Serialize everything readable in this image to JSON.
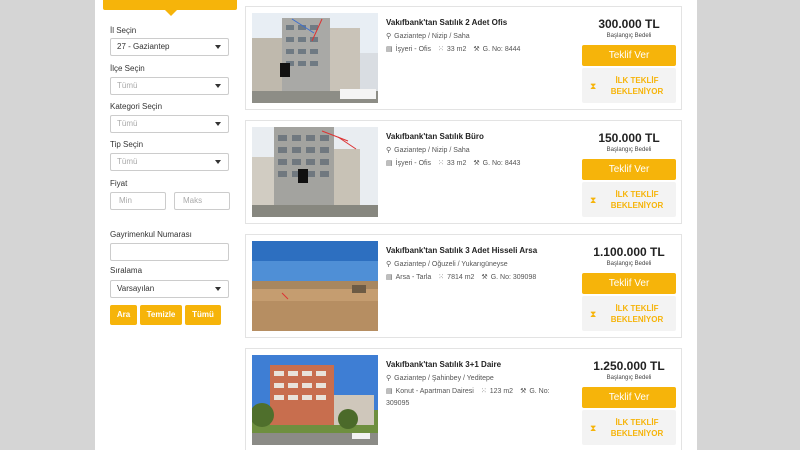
{
  "filters": {
    "il_label": "İl Seçin",
    "il_value": "27 - Gaziantep",
    "ilce_label": "İlçe Seçin",
    "ilce_value": "Tümü",
    "kategori_label": "Kategori Seçin",
    "kategori_value": "Tümü",
    "tip_label": "Tip Seçin",
    "tip_value": "Tümü",
    "fiyat_label": "Fiyat",
    "min_placeholder": "Min",
    "max_placeholder": "Maks",
    "numara_label": "Gayrimenkul Numarası",
    "numara_value": "",
    "siralama_label": "Sıralama",
    "siralama_value": "Varsayılan",
    "btn_ara": "Ara",
    "btn_temizle": "Temizle",
    "btn_tumu": "Tümü"
  },
  "listings": [
    {
      "title": "Vakıfbank'tan Satılık 2 Adet Ofis",
      "location": "Gaziantep / Nizip / Saha",
      "type": "İşyeri - Ofis",
      "area": "33 m2",
      "gno": "G. No: 8444",
      "price": "300.000 TL",
      "price_sub": "Başlangıç Bedeli",
      "offer": "Teklif Ver",
      "waiting": "İLK TEKLİF BEKLENİYOR"
    },
    {
      "title": "Vakıfbank'tan Satılık Büro",
      "location": "Gaziantep / Nizip / Saha",
      "type": "İşyeri - Ofis",
      "area": "33 m2",
      "gno": "G. No: 8443",
      "price": "150.000 TL",
      "price_sub": "Başlangıç Bedeli",
      "offer": "Teklif Ver",
      "waiting": "İLK TEKLİF BEKLENİYOR"
    },
    {
      "title": "Vakıfbank'tan Satılık 3 Adet Hisseli Arsa",
      "location": "Gaziantep / Oğuzeli / Yukarıgüneyse",
      "type": "Arsa - Tarla",
      "area": "7814 m2",
      "gno": "G. No: 309098",
      "price": "1.100.000 TL",
      "price_sub": "Başlangıç Bedeli",
      "offer": "Teklif Ver",
      "waiting": "İLK TEKLİF BEKLENİYOR"
    },
    {
      "title": "Vakıfbank'tan Satılık 3+1 Daire",
      "location": "Gaziantep / Şahinbey / Yeditepe",
      "type": "Konut - Apartman Dairesi",
      "area": "123 m2",
      "gno": "G. No: 309095",
      "price": "1.250.000 TL",
      "price_sub": "Başlangıç Bedeli",
      "offer": "Teklif Ver",
      "waiting": "İLK TEKLİF BEKLENİYOR"
    }
  ],
  "colors": {
    "accent": "#f6b40a",
    "background": "#d5d5d5"
  }
}
